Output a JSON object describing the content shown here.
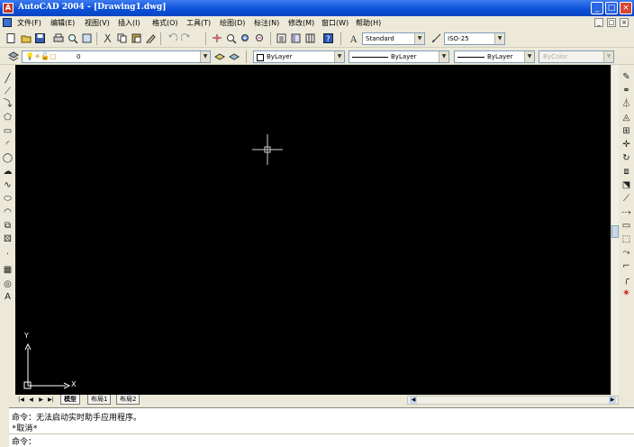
{
  "window": {
    "title": "AutoCAD 2004 - [Drawing1.dwg]",
    "app_icon": "A",
    "controls": [
      "_",
      "□",
      "×"
    ]
  },
  "menu": {
    "items": [
      "文件(F)",
      "编辑(E)",
      "视图(V)",
      "插入(I)",
      "格式(O)",
      "工具(T)",
      "绘图(D)",
      "标注(N)",
      "修改(M)",
      "窗口(W)",
      "帮助(H)"
    ],
    "doc_controls": [
      "_",
      "□",
      "×"
    ]
  },
  "standard_toolbar": {
    "text_style": "Standard",
    "dim_style": "ISO-25"
  },
  "properties_toolbar": {
    "layer": "0",
    "color": "ByLayer",
    "linetype": "ByLayer",
    "lineweight": "ByLayer",
    "plot_style": "ByColor"
  },
  "drawing": {
    "background": "#000000",
    "crosshair_color": "#cfcfcf",
    "ucs_color": "#ffffff",
    "ucs_x_label": "X",
    "ucs_y_label": "Y"
  },
  "layout_tabs": {
    "nav": [
      "|◀",
      "◀",
      "▶",
      "▶|"
    ],
    "tabs": [
      "模型",
      "布局1",
      "布局2"
    ],
    "active": "模型"
  },
  "command": {
    "line1": "命令：无法启动实时助手应用程序。",
    "line2": "*取消*",
    "prompt": "命令："
  }
}
